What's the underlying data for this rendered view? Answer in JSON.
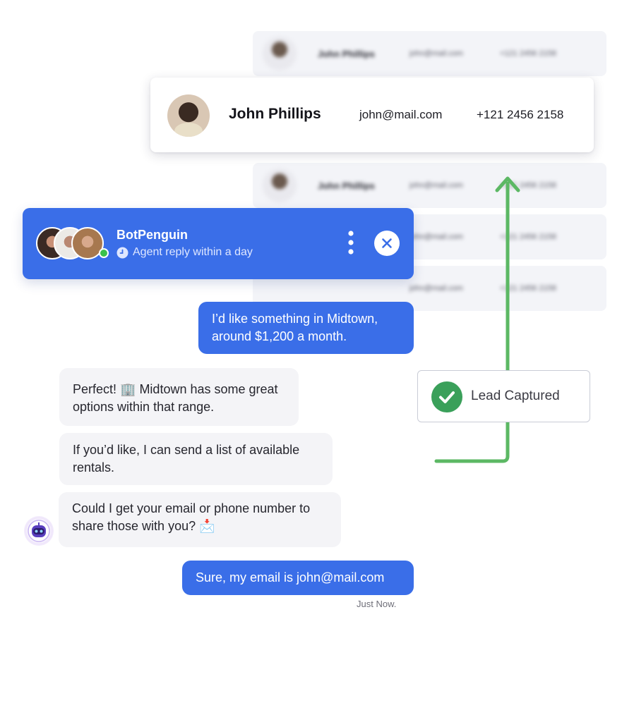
{
  "contacts": {
    "background_rows": [
      {
        "name": "John Phillips",
        "email": "john@mail.com",
        "phone": "+121 2456 2158"
      },
      {
        "name": "John Phillips",
        "email": "john@mail.com",
        "phone": "+121 2456 2158"
      },
      {
        "name": "",
        "email": "john@mail.com",
        "phone": "+121 2456 2158"
      },
      {
        "name": "",
        "email": "john@mail.com",
        "phone": "+121 2456 2158"
      }
    ],
    "highlighted": {
      "name": "John Phillips",
      "email": "john@mail.com",
      "phone": "+121 2456 2158"
    }
  },
  "lead_badge": {
    "label": "Lead Captured",
    "icon": "check-circle-icon",
    "color": "#3aa05a"
  },
  "chat": {
    "header": {
      "bot_name": "BotPenguin",
      "reply_time": "Agent reply within a day",
      "status": "online",
      "icons": [
        "clock-icon",
        "more-vertical-icon",
        "close-icon"
      ]
    },
    "messages": [
      {
        "sender": "user",
        "text": "I’d like something in Midtown, around $1,200 a month."
      },
      {
        "sender": "bot",
        "text": "Perfect! 🏢  Midtown has some great options within that range."
      },
      {
        "sender": "bot",
        "text": "If you’d like, I can send a list of available rentals."
      },
      {
        "sender": "bot",
        "text": "Could I get your email or phone number to share those with you? 📩"
      },
      {
        "sender": "user",
        "text": "Sure, my email is john@mail.com"
      }
    ],
    "timestamp": "Just Now."
  },
  "colors": {
    "primary": "#3a6ee8",
    "bot_bubble": "#f4f4f7",
    "success": "#3aa05a",
    "arrow": "#5cb864"
  }
}
